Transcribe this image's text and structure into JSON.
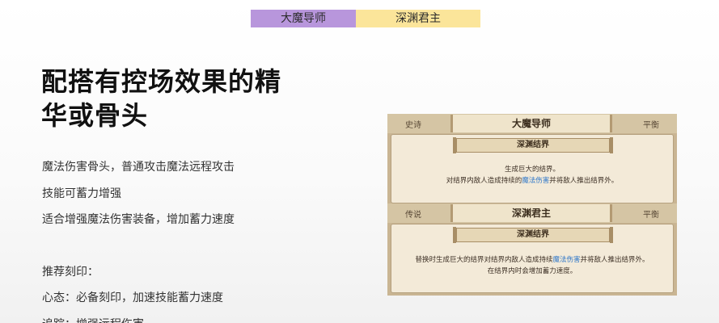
{
  "tags": [
    "大魔导师",
    "深渊君主"
  ],
  "headline": [
    "配搭有控场效果的精",
    "华或骨头"
  ],
  "body": {
    "lines": [
      "魔法伤害骨头，普通攻击魔法远程攻击",
      "技能可蓄力增强",
      "适合增强魔法伤害装备，增加蓄力速度"
    ],
    "recommend": [
      "推荐刻印：",
      "心态：必备刻印，加速技能蓄力速度",
      "追踪：增强远程伤害"
    ]
  },
  "card": {
    "row1": {
      "rarity_left": "史诗",
      "name": "大魔导师",
      "rarity_right": "平衡",
      "skill": "深渊结界",
      "desc_line1": "生成巨大的结界。",
      "desc_line2_pre": "对结界内敌人造成持续的",
      "desc_line2_hl": "魔法伤害",
      "desc_line2_post": "并将敌人推出结界外。"
    },
    "row2": {
      "rarity_left": "传说",
      "name": "深渊君主",
      "rarity_right": "平衡",
      "skill": "深渊结界",
      "desc_line1_pre": "替换时生成巨大的结界对结界内敌人造成持续",
      "desc_line1_hl": "魔法伤害",
      "desc_line1_post": "并将敌人推出结界外。",
      "desc_line2": "在结界内时会增加蓄力速度。"
    }
  }
}
